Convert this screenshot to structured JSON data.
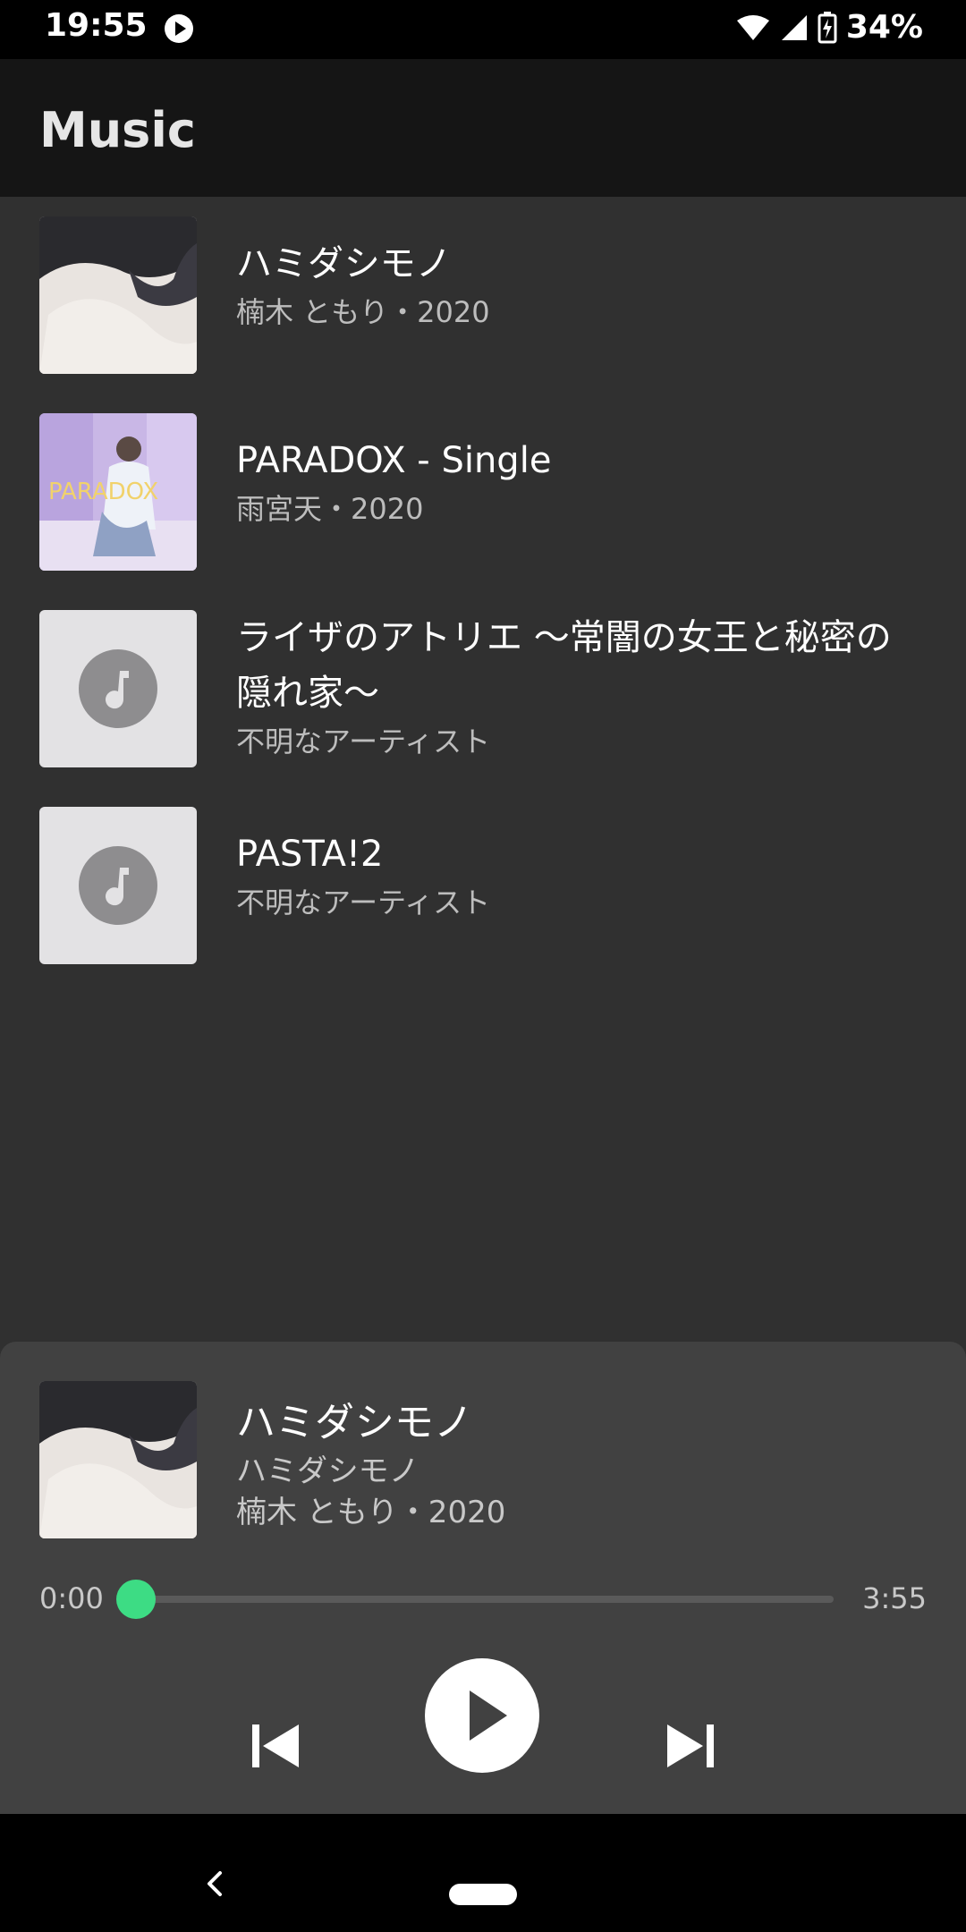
{
  "status": {
    "time": "19:55",
    "battery": "34%",
    "icons": [
      "play-icon",
      "wifi-icon",
      "signal-icon",
      "battery-icon"
    ]
  },
  "app": {
    "title": "Music"
  },
  "albums": [
    {
      "title": "ハミダシモノ",
      "subtitle": "楠木 ともり・2020",
      "art": "photo"
    },
    {
      "title": "PARADOX - Single",
      "subtitle": "雨宮天・2020",
      "art": "photo"
    },
    {
      "title": "ライザのアトリエ ～常闇の女王と秘密の隠れ家～",
      "subtitle": "不明なアーティスト",
      "art": "placeholder-music-icon"
    },
    {
      "title": "PASTA!2",
      "subtitle": "不明なアーティスト",
      "art": "placeholder-music-icon"
    }
  ],
  "player": {
    "title": "ハミダシモノ",
    "album": "ハミダシモノ",
    "artist_year": "楠木 ともり・2020",
    "current_time": "0:00",
    "total_time": "3:55",
    "progress": 0,
    "accent": "#3ddc84",
    "controls": [
      "skip-previous-icon",
      "play-icon",
      "skip-next-icon"
    ]
  },
  "navigation": {
    "icons": [
      "back-icon",
      "home-pill"
    ]
  }
}
